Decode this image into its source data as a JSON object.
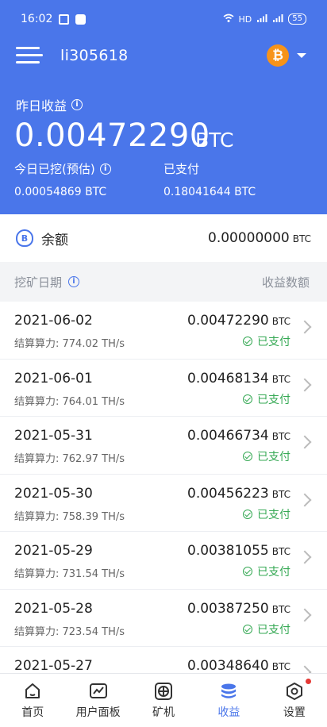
{
  "status": {
    "time": "16:02",
    "network": "HD",
    "battery": "55"
  },
  "header": {
    "username": "li305618",
    "coin_symbol": "₿",
    "yesterday_label": "昨日收益",
    "yesterday_amount": "0.00472290",
    "yesterday_unit": "BTC",
    "today_label": "今日已挖(预估)",
    "today_value": "0.00054869 BTC",
    "paid_label": "已支付",
    "paid_value": "0.18041644 BTC",
    "info_glyph": "i"
  },
  "balance": {
    "icon_glyph": "B",
    "label": "余额",
    "value": "0.00000000",
    "unit": "BTC"
  },
  "list": {
    "date_header": "挖矿日期",
    "amount_header": "收益数额",
    "unit": "BTC",
    "rows": [
      {
        "date": "2021-06-02",
        "power": "结算算力: 774.02 TH/s",
        "amount": "0.00472290",
        "status": "已支付"
      },
      {
        "date": "2021-06-01",
        "power": "结算算力: 764.01 TH/s",
        "amount": "0.00468134",
        "status": "已支付"
      },
      {
        "date": "2021-05-31",
        "power": "结算算力: 762.97 TH/s",
        "amount": "0.00466734",
        "status": "已支付"
      },
      {
        "date": "2021-05-30",
        "power": "结算算力: 758.39 TH/s",
        "amount": "0.00456223",
        "status": "已支付"
      },
      {
        "date": "2021-05-29",
        "power": "结算算力: 731.54 TH/s",
        "amount": "0.00381055",
        "status": "已支付"
      },
      {
        "date": "2021-05-28",
        "power": "结算算力: 723.54 TH/s",
        "amount": "0.00387250",
        "status": "已支付"
      },
      {
        "date": "2021-05-27",
        "power": "",
        "amount": "0.00348640",
        "status": ""
      }
    ]
  },
  "nav": [
    {
      "label": "首页",
      "icon": "home-icon"
    },
    {
      "label": "用户面板",
      "icon": "chart-panel-icon"
    },
    {
      "label": "矿机",
      "icon": "miner-icon"
    },
    {
      "label": "收益",
      "icon": "coins-stack-icon",
      "active": true
    },
    {
      "label": "设置",
      "icon": "settings-icon"
    }
  ],
  "colors": {
    "primary": "#4a76ea",
    "success": "#34a853",
    "bitcoin": "#f7931a",
    "alert": "#e53935"
  }
}
